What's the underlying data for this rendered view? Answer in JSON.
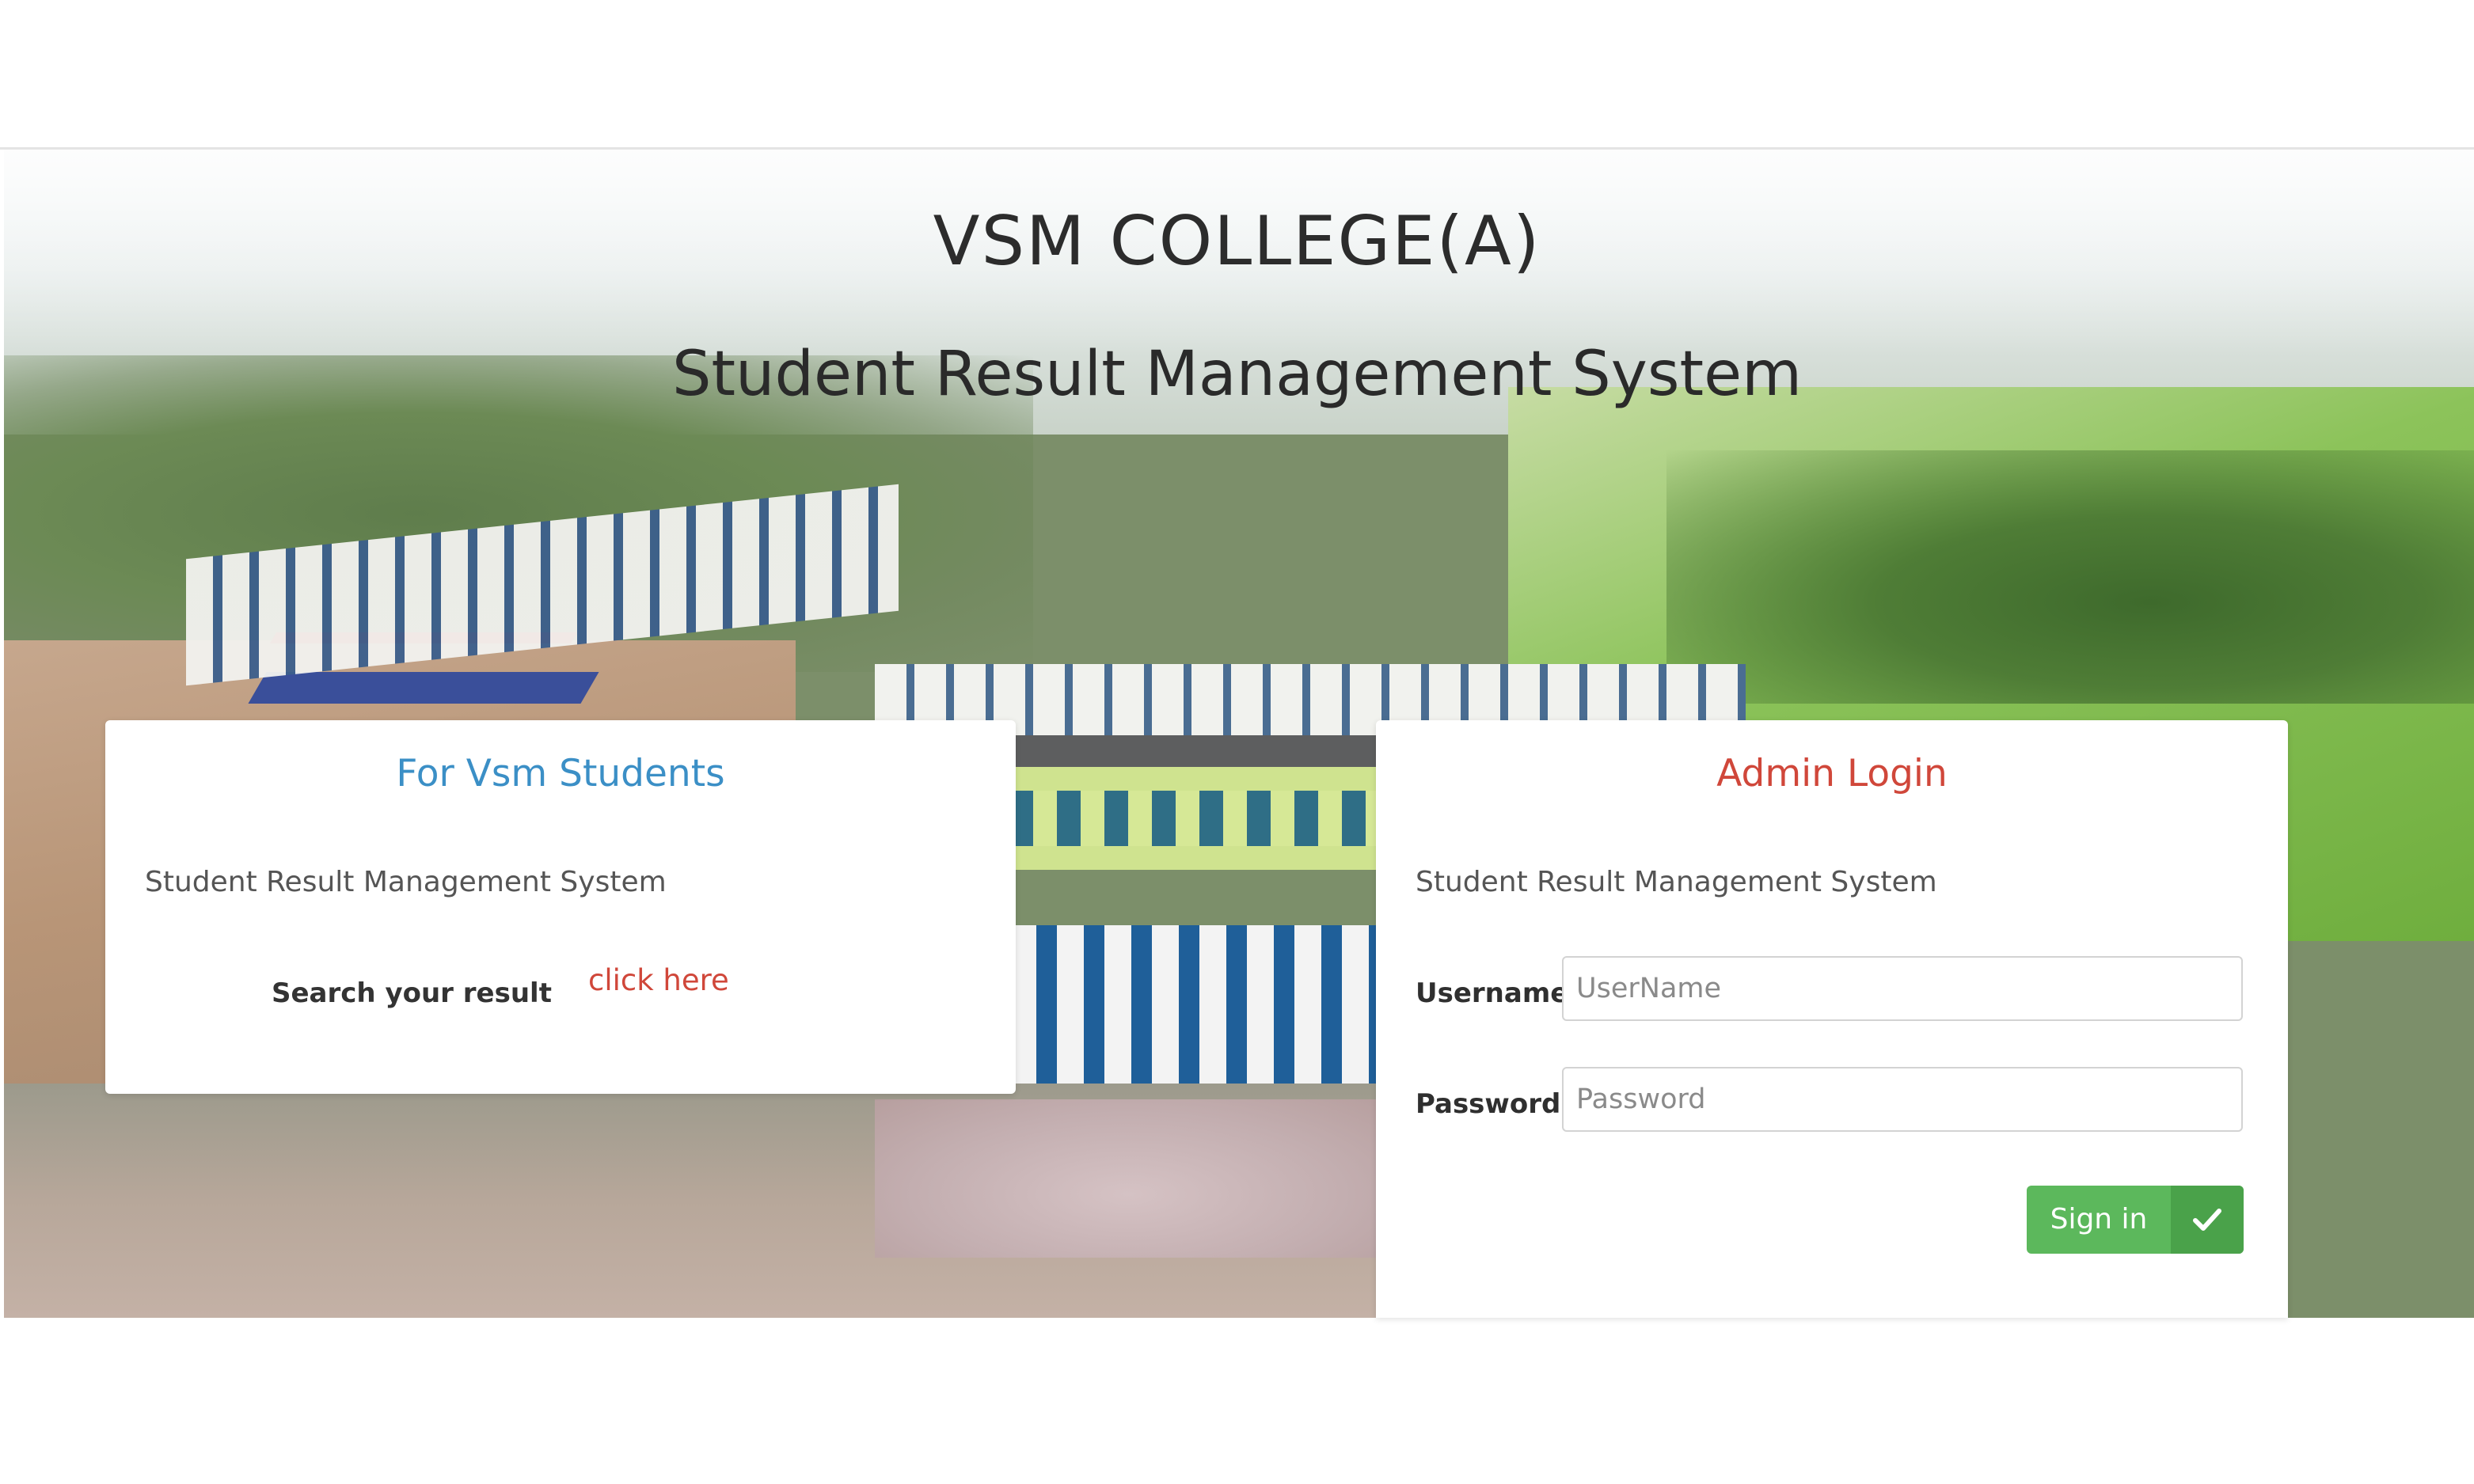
{
  "header": {
    "college_name": "VSM COLLEGE(A)",
    "system_title": "Student Result Management System"
  },
  "students_card": {
    "title": "For Vsm Students",
    "description": "Student Result Management System",
    "search_label": "Search your result",
    "link_text": "click here"
  },
  "admin_card": {
    "title": "Admin Login",
    "description": "Student Result Management System",
    "username_label": "Username",
    "username_placeholder": "UserName",
    "password_label": "Password",
    "password_placeholder": "Password",
    "signin_label": "Sign in",
    "signin_icon": "check-icon"
  },
  "colors": {
    "students_title": "#3b8fc6",
    "admin_title": "#d0473a",
    "link": "#d0473a",
    "signin_button": "#5cb85c"
  }
}
